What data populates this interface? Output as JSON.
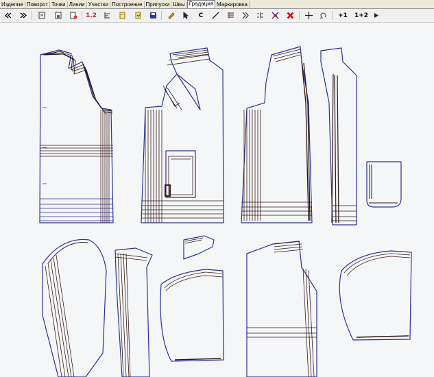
{
  "menu_tabs": [
    "Изделие",
    "Поворот",
    "Точки",
    "Линии",
    "Участки",
    "Построение",
    "Припуски",
    "Швы",
    "Градация",
    "Маркировка"
  ],
  "active_tab_index": 8,
  "toolbar": {
    "label_1_2": "1.2",
    "label_c": "C",
    "label_plus1": "+1",
    "label_1plus2": "1+2"
  },
  "icons": [
    "back-icon",
    "forward-icon",
    "open-file-icon",
    "save-file-icon",
    "print-icon",
    "scale-icon",
    "align-icon",
    "copy-icon",
    "paste-icon",
    "disk-icon",
    "pencil-icon",
    "select-icon",
    "curve-icon",
    "line-icon",
    "grade-icon",
    "arrows-icon",
    "split-icon",
    "cut-icon",
    "delete-icon",
    "crosshair-icon",
    "rotate-icon",
    "play-icon"
  ],
  "colors": {
    "canvas_bg": "#f4f6f7",
    "pattern_blue": "#2b2f9a",
    "pattern_dark": "#2a1414",
    "delete_red": "#cc0000",
    "label_red": "#cc2222"
  }
}
